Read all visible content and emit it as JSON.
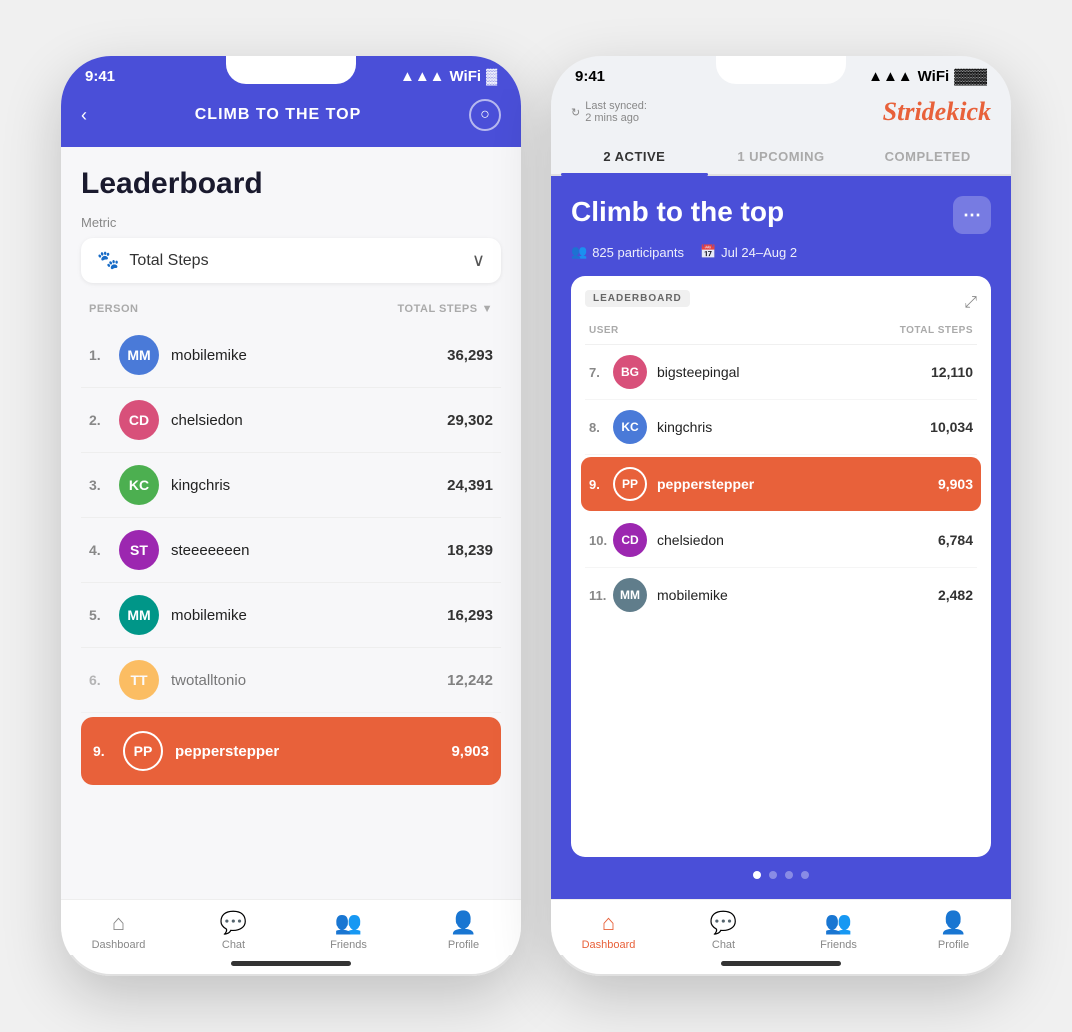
{
  "leftPhone": {
    "statusTime": "9:41",
    "header": {
      "backLabel": "‹",
      "title": "CLIMB TO THE TOP",
      "chatIcon": "💬"
    },
    "leaderboard": {
      "title": "Leaderboard",
      "metricLabel": "Metric",
      "metricValue": "Total Steps",
      "metricIconEmoji": "👟",
      "tableHeaders": {
        "person": "PERSON",
        "steps": "TOTAL STEPS"
      },
      "rows": [
        {
          "rank": "1.",
          "name": "mobilemike",
          "steps": "36,293",
          "avatarClass": "av-blue",
          "initials": "MM",
          "highlighted": false
        },
        {
          "rank": "2.",
          "name": "chelsiedon",
          "steps": "29,302",
          "avatarClass": "av-pink",
          "initials": "CD",
          "highlighted": false
        },
        {
          "rank": "3.",
          "name": "kingchris",
          "steps": "24,391",
          "avatarClass": "av-green",
          "initials": "KC",
          "highlighted": false
        },
        {
          "rank": "4.",
          "name": "steeeeeeen",
          "steps": "18,239",
          "avatarClass": "av-purple",
          "initials": "ST",
          "highlighted": false
        },
        {
          "rank": "5.",
          "name": "mobilemike",
          "steps": "16,293",
          "avatarClass": "av-teal",
          "initials": "MM",
          "highlighted": false
        },
        {
          "rank": "6.",
          "name": "twotalltonio",
          "steps": "12,242",
          "avatarClass": "av-amber",
          "initials": "TT",
          "highlighted": false
        },
        {
          "rank": "9.",
          "name": "pepperstepper",
          "steps": "9,903",
          "avatarClass": "av-orange",
          "initials": "PP",
          "highlighted": true
        }
      ]
    },
    "bottomNav": [
      {
        "icon": "⌂",
        "label": "Dashboard",
        "active": false
      },
      {
        "icon": "💬",
        "label": "Chat",
        "active": false
      },
      {
        "icon": "👥",
        "label": "Friends",
        "active": false
      },
      {
        "icon": "👤",
        "label": "Profile",
        "active": false
      }
    ]
  },
  "rightPhone": {
    "statusTime": "9:41",
    "syncText": "Last synced:",
    "syncTime": "2 mins ago",
    "logo": "Stridekick",
    "tabs": [
      {
        "label": "2 ACTIVE",
        "active": true
      },
      {
        "label": "1 UPCOMING",
        "active": false
      },
      {
        "label": "COMPLETED",
        "active": false
      }
    ],
    "challenge": {
      "title": "Climb to the top",
      "participants": "825 participants",
      "dateRange": "Jul 24–Aug 2",
      "moreLabel": "⋯"
    },
    "leaderboard": {
      "tagLabel": "LEADERBOARD",
      "tableHeaders": {
        "user": "USER",
        "steps": "TOTAL STEPS"
      },
      "rows": [
        {
          "rank": "7.",
          "name": "bigsteepingal",
          "steps": "12,110",
          "avatarClass": "av-pink",
          "initials": "BG",
          "highlighted": false
        },
        {
          "rank": "8.",
          "name": "kingchris",
          "steps": "10,034",
          "avatarClass": "av-blue",
          "initials": "KC",
          "highlighted": false
        },
        {
          "rank": "9.",
          "name": "pepperstepper",
          "steps": "9,903",
          "avatarClass": "av-orange",
          "initials": "PP",
          "highlighted": true
        },
        {
          "rank": "10.",
          "name": "chelsiedon",
          "steps": "6,784",
          "avatarClass": "av-purple",
          "initials": "CD",
          "highlighted": false
        },
        {
          "rank": "11.",
          "name": "mobilemike",
          "steps": "2,482",
          "avatarClass": "av-gray",
          "initials": "MM",
          "highlighted": false
        }
      ]
    },
    "dots": [
      true,
      false,
      false,
      false
    ],
    "bottomNav": [
      {
        "icon": "⌂",
        "label": "Dashboard",
        "active": true
      },
      {
        "icon": "💬",
        "label": "Chat",
        "active": false
      },
      {
        "icon": "👥",
        "label": "Friends",
        "active": false
      },
      {
        "icon": "👤",
        "label": "Profile",
        "active": false
      }
    ]
  }
}
